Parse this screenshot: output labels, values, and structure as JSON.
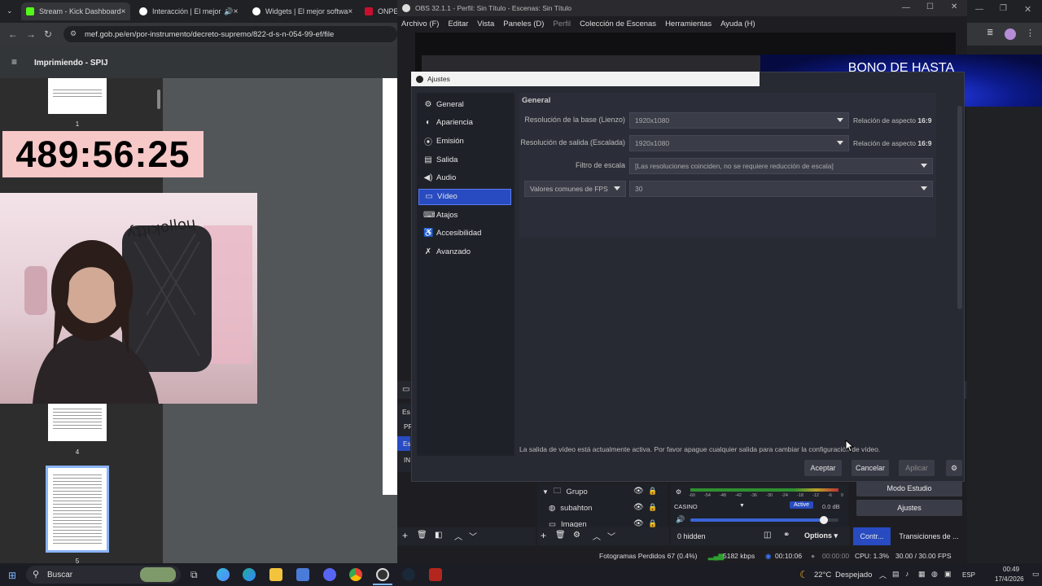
{
  "browser": {
    "tabs": [
      {
        "title": "Stream - Kick Dashboard",
        "color": "#53fc18"
      },
      {
        "title": "Interacción | El mejor",
        "color": "#ffffff"
      },
      {
        "title": "Widgets | El mejor softwa",
        "color": "#ffffff"
      },
      {
        "title": "ONPE",
        "color": "#c8102e"
      }
    ],
    "url": "mef.gob.pe/en/por-instrumento/decreto-supremo/822-d-s-n-054-99-ef/file"
  },
  "pdf": {
    "title": "Imprimiendo - SPIJ",
    "pages": [
      "1",
      "4",
      "5"
    ]
  },
  "overlay": {
    "timer": "489:56:25",
    "banner": "BONO DE HASTA"
  },
  "obs": {
    "title": "OBS 32.1.1 - Perfil: Sin Título - Escenas: Sin Título",
    "menu": [
      "Archivo (F)",
      "Editar",
      "Vista",
      "Paneles (D)",
      "Perfil",
      "Colección de Escenas",
      "Herramientas",
      "Ayuda (H)"
    ],
    "settings": {
      "title": "Ajustes",
      "nav": [
        {
          "label": "General",
          "icon": "gear-icon"
        },
        {
          "label": "Apariencia",
          "icon": "palette-icon"
        },
        {
          "label": "Emisión",
          "icon": "broadcast-icon"
        },
        {
          "label": "Salida",
          "icon": "output-icon"
        },
        {
          "label": "Audio",
          "icon": "speaker-icon"
        },
        {
          "label": "Vídeo",
          "icon": "monitor-icon"
        },
        {
          "label": "Atajos",
          "icon": "keyboard-icon"
        },
        {
          "label": "Accesibilidad",
          "icon": "accessibility-icon"
        },
        {
          "label": "Avanzado",
          "icon": "wrench-icon"
        }
      ],
      "active": "Vídeo",
      "section": "General",
      "base_label": "Resolución de la base (Lienzo)",
      "base_value": "1920x1080",
      "output_label": "Resolución de salida (Escalada)",
      "output_value": "1920x1080",
      "ratio_label": "Relación de aspecto",
      "ratio_value": "16:9",
      "filter_label": "Filtro de escala",
      "filter_value": "[Las resoluciones coinciden, no se requiere reducción de escala]",
      "fps_label": "Valores comunes de FPS",
      "fps_value": "30",
      "note": "La salida de vídeo está actualmente activa. Por favor apague cualquier salida para cambiar la configuración de vídeo.",
      "buttons": {
        "ok": "Aceptar",
        "cancel": "Cancelar",
        "apply": "Aplicar"
      }
    },
    "sources": [
      {
        "label": "Grupo"
      },
      {
        "label": "subahton"
      },
      {
        "label": "Imagen"
      }
    ],
    "mixer": {
      "scale": [
        "-60",
        "-54",
        "-48",
        "-42",
        "-36",
        "-30",
        "-24",
        "-18",
        "-12",
        "-6",
        "0"
      ],
      "track": "CASINO",
      "badge": "Active",
      "db": "0.0 dB",
      "hidden": "0 hidden",
      "options": "Options",
      "volume": 0.9
    },
    "controls": {
      "studio": "Modo Estudio",
      "settings": "Ajustes",
      "controls_tab": "Contr...",
      "transitions_tab": "Transiciones de ..."
    },
    "scene_labels": [
      "Es",
      "PR",
      "Es",
      "IN"
    ],
    "status": {
      "dropped": "Fotogramas Perdidos 67 (0.4%)",
      "bitrate": "5182 kbps",
      "stream_time": "00:10:06",
      "rec_time": "00:00:00",
      "cpu": "CPU: 1.3%",
      "fps": "30.00 / 30.00 FPS"
    }
  },
  "taskbar": {
    "search": "Buscar",
    "temp": "22°C",
    "weather": "Despejado",
    "lang": "ESP",
    "time": "00:49",
    "date": "17/4/2026"
  }
}
